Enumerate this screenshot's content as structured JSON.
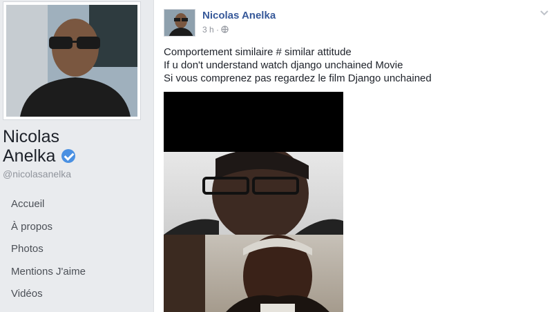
{
  "profile": {
    "name_line1": "Nicolas",
    "name_line2": "Anelka",
    "handle": "@nicolasanelka"
  },
  "nav": {
    "items": [
      "Accueil",
      "À propos",
      "Photos",
      "Mentions J'aime",
      "Vidéos"
    ]
  },
  "post": {
    "author": "Nicolas Anelka",
    "time": "3 h",
    "separator": "·",
    "privacy_icon": "globe-icon",
    "text_lines": [
      "Comportement similaire # similar attitude",
      "If u don't understand watch django unchained Movie",
      "Si vous comprenez pas regardez le film Django unchained"
    ]
  },
  "colors": {
    "link": "#365899",
    "verified": "#4a90e2",
    "page_bg": "#e9ebee"
  }
}
